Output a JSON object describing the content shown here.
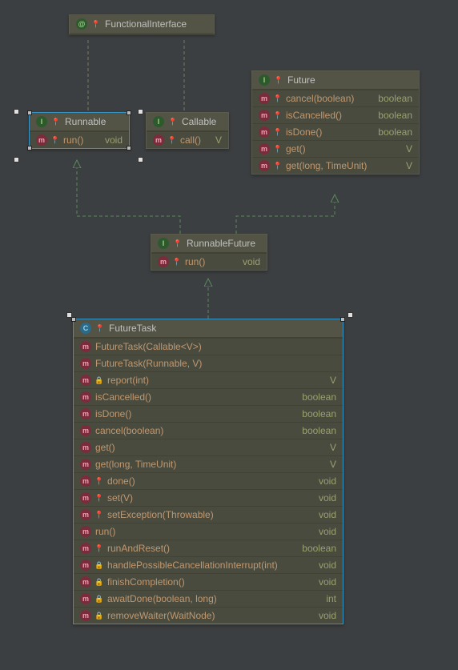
{
  "nodes": {
    "functionalInterface": {
      "title": "FunctionalInterface",
      "kind_icon": "@",
      "members": []
    },
    "runnable": {
      "title": "Runnable",
      "kind_icon": "I",
      "members": [
        {
          "icon": "m",
          "mod": "pin",
          "name": "run()",
          "ret": "void"
        }
      ]
    },
    "callable": {
      "title": "Callable",
      "kind_icon": "I",
      "members": [
        {
          "icon": "m",
          "mod": "pin",
          "name": "call()",
          "ret": "V"
        }
      ]
    },
    "future": {
      "title": "Future",
      "kind_icon": "I",
      "members": [
        {
          "icon": "m",
          "mod": "pin",
          "name": "cancel(boolean)",
          "ret": "boolean"
        },
        {
          "icon": "m",
          "mod": "pin",
          "name": "isCancelled()",
          "ret": "boolean"
        },
        {
          "icon": "m",
          "mod": "pin",
          "name": "isDone()",
          "ret": "boolean"
        },
        {
          "icon": "m",
          "mod": "pin",
          "name": "get()",
          "ret": "V"
        },
        {
          "icon": "m",
          "mod": "pin",
          "name": "get(long, TimeUnit)",
          "ret": "V"
        }
      ]
    },
    "runnableFuture": {
      "title": "RunnableFuture",
      "kind_icon": "I",
      "members": [
        {
          "icon": "m",
          "mod": "pin",
          "name": "run()",
          "ret": "void"
        }
      ]
    },
    "futureTask": {
      "title": "FutureTask",
      "kind_icon": "C",
      "members": [
        {
          "icon": "m",
          "mod": "",
          "name": "FutureTask(Callable<V>)",
          "ret": ""
        },
        {
          "icon": "m",
          "mod": "",
          "name": "FutureTask(Runnable, V)",
          "ret": ""
        },
        {
          "icon": "m",
          "mod": "lock",
          "name": "report(int)",
          "ret": "V"
        },
        {
          "icon": "m",
          "mod": "",
          "name": "isCancelled()",
          "ret": "boolean"
        },
        {
          "icon": "m",
          "mod": "",
          "name": "isDone()",
          "ret": "boolean"
        },
        {
          "icon": "m",
          "mod": "",
          "name": "cancel(boolean)",
          "ret": "boolean"
        },
        {
          "icon": "m",
          "mod": "",
          "name": "get()",
          "ret": "V"
        },
        {
          "icon": "m",
          "mod": "",
          "name": "get(long, TimeUnit)",
          "ret": "V"
        },
        {
          "icon": "m",
          "mod": "pin",
          "name": "done()",
          "ret": "void"
        },
        {
          "icon": "m",
          "mod": "pin",
          "name": "set(V)",
          "ret": "void"
        },
        {
          "icon": "m",
          "mod": "pin",
          "name": "setException(Throwable)",
          "ret": "void"
        },
        {
          "icon": "m",
          "mod": "",
          "name": "run()",
          "ret": "void"
        },
        {
          "icon": "m",
          "mod": "pin",
          "name": "runAndReset()",
          "ret": "boolean"
        },
        {
          "icon": "m",
          "mod": "lock",
          "name": "handlePossibleCancellationInterrupt(int)",
          "ret": "void"
        },
        {
          "icon": "m",
          "mod": "lock",
          "name": "finishCompletion()",
          "ret": "void"
        },
        {
          "icon": "m",
          "mod": "lock",
          "name": "awaitDone(boolean, long)",
          "ret": "int"
        },
        {
          "icon": "m",
          "mod": "lock",
          "name": "removeWaiter(WaitNode)",
          "ret": "void"
        }
      ]
    }
  }
}
